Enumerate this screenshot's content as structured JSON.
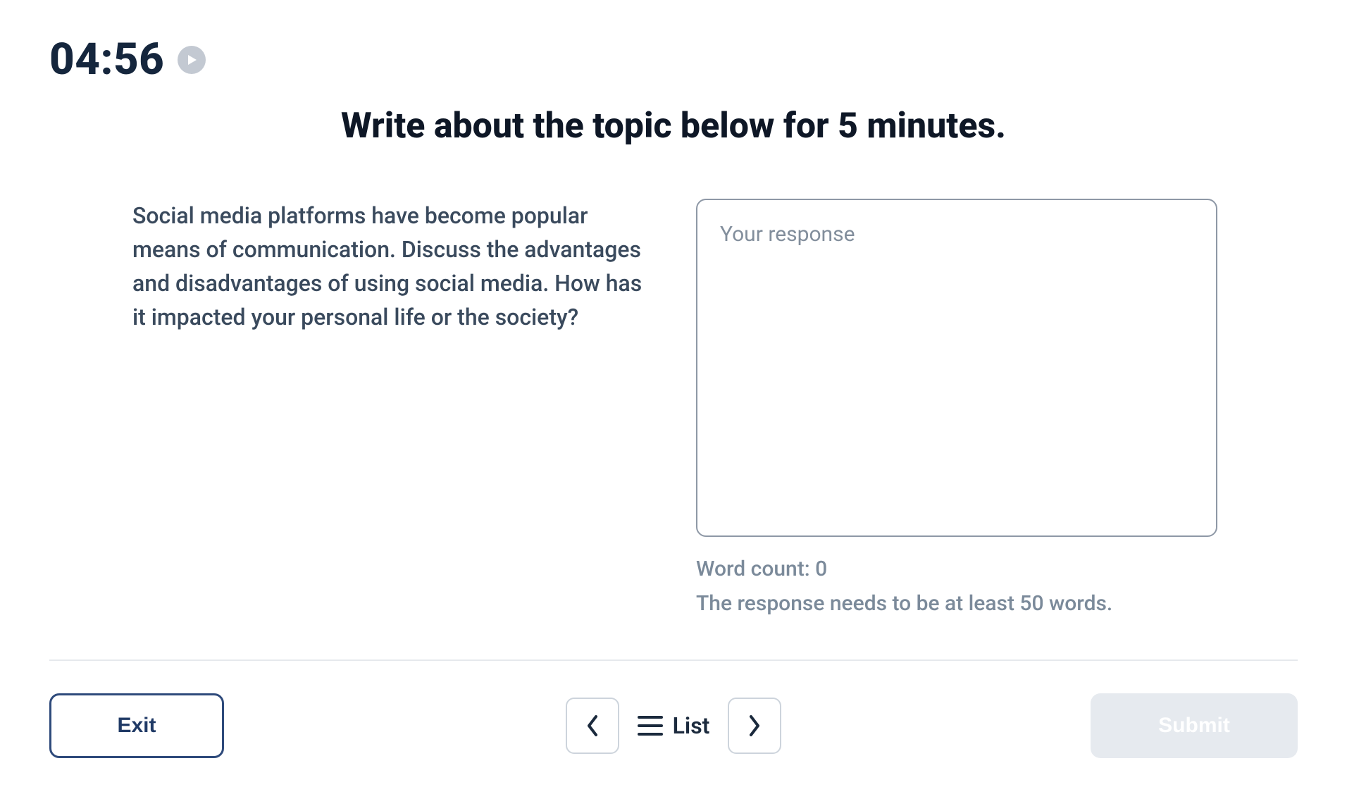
{
  "timer": {
    "value": "04:56"
  },
  "title": "Write about the topic below for 5 minutes.",
  "prompt": "Social media platforms have become popular means of communication. Discuss the advantages and disadvantages of using social media. How has it impacted your personal life or the society?",
  "response": {
    "placeholder": "Your response",
    "value": "",
    "word_count_label": "Word count: 0",
    "requirement": "The response needs to be at least 50 words."
  },
  "footer": {
    "exit": "Exit",
    "list": "List",
    "submit": "Submit"
  }
}
